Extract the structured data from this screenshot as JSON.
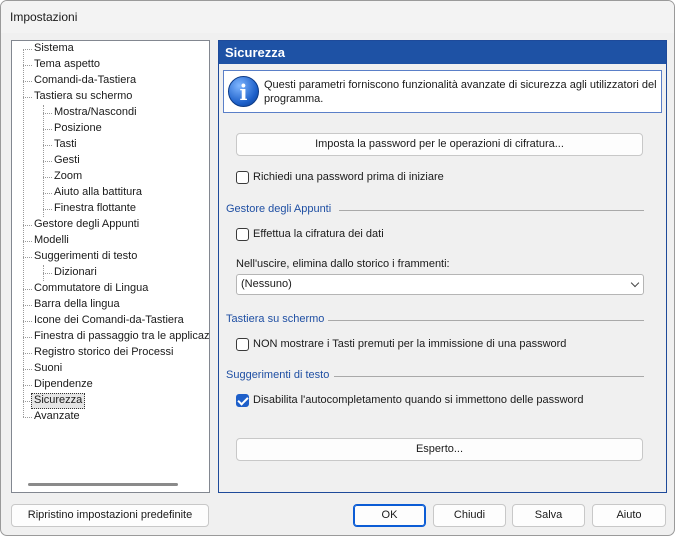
{
  "window": {
    "title": "Impostazioni"
  },
  "tree": {
    "items": [
      {
        "label": "Sistema"
      },
      {
        "label": "Tema aspetto"
      },
      {
        "label": "Comandi-da-Tastiera"
      },
      {
        "label": "Tastiera su schermo"
      },
      {
        "label": "Mostra/Nascondi"
      },
      {
        "label": "Posizione"
      },
      {
        "label": "Tasti"
      },
      {
        "label": "Gesti"
      },
      {
        "label": "Zoom"
      },
      {
        "label": "Aiuto alla battitura"
      },
      {
        "label": "Finestra flottante"
      },
      {
        "label": "Gestore degli Appunti"
      },
      {
        "label": "Modelli"
      },
      {
        "label": "Suggerimenti di testo"
      },
      {
        "label": "Dizionari"
      },
      {
        "label": "Commutatore di Lingua"
      },
      {
        "label": "Barra della lingua"
      },
      {
        "label": "Icone dei Comandi-da-Tastiera"
      },
      {
        "label": "Finestra di passaggio tra le applicazioni"
      },
      {
        "label": "Registro storico dei Processi"
      },
      {
        "label": "Suoni"
      },
      {
        "label": "Dipendenze"
      },
      {
        "label": "Sicurezza"
      },
      {
        "label": "Avanzate"
      }
    ],
    "selected": "Sicurezza"
  },
  "panel": {
    "title": "Sicurezza",
    "info_icon": "info-icon",
    "info_text": "Questi parametri forniscono funzionalità avanzate di sicurezza agli utilizzatori del programma.",
    "set_password_button": "Imposta la password per le operazioni di cifratura...",
    "require_password": {
      "label": "Richiedi una password prima di iniziare",
      "checked": false
    },
    "clipboard_section": "Gestore degli Appunti",
    "encrypt_data": {
      "label": "Effettua la cifratura dei dati",
      "checked": false
    },
    "on_exit_label": "Nell'uscire, elimina dallo storico i frammenti:",
    "on_exit_value": "(Nessuno)",
    "osk_section": "Tastiera su schermo",
    "hide_keys": {
      "label": "NON mostrare i Tasti premuti per la immissione di una password",
      "checked": false
    },
    "suggest_section": "Suggerimenti di testo",
    "disable_autocomplete": {
      "label": "Disabilita l'autocompletamento quando si immettono delle password",
      "checked": true
    },
    "expert_button": "Esperto..."
  },
  "footer": {
    "reset_button": "Ripristino impostazioni predefinite",
    "ok_button": "OK",
    "close_button": "Chiudi",
    "save_button": "Salva",
    "help_button": "Aiuto"
  },
  "colors": {
    "accent": "#1e52a5",
    "section": "#1f4fa3",
    "check": "#1e5fc9"
  }
}
